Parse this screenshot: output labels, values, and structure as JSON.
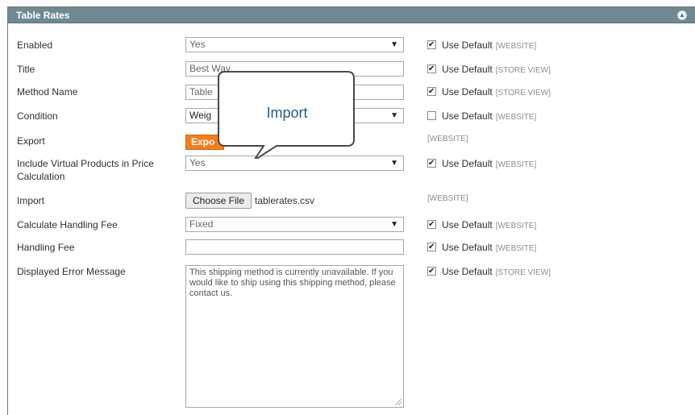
{
  "section": {
    "title": "Table Rates"
  },
  "fields": {
    "enabled": {
      "label": "Enabled",
      "value": "Yes",
      "use_default": "Use Default",
      "scope": "[WEBSITE]",
      "checked": true
    },
    "title": {
      "label": "Title",
      "value": "Best Way",
      "use_default": "Use Default",
      "scope": "[STORE VIEW]",
      "checked": true
    },
    "method_name": {
      "label": "Method Name",
      "value": "Table",
      "use_default": "Use Default",
      "scope": "[STORE VIEW]",
      "checked": true
    },
    "condition": {
      "label": "Condition",
      "value": "Weig",
      "use_default": "Use Default",
      "scope": "[WEBSITE]",
      "checked": false
    },
    "export": {
      "label": "Export",
      "button": "Expo",
      "scope": "[WEBSITE]"
    },
    "include_virtual": {
      "label_line1": "Include Virtual Products in Price",
      "label_line2": "Calculation",
      "value": "Yes",
      "use_default": "Use Default",
      "scope": "[WEBSITE]",
      "checked": true
    },
    "import": {
      "label": "Import",
      "button": "Choose File",
      "filename": "tablerates.csv",
      "scope": "[WEBSITE]"
    },
    "handling_calc": {
      "label": "Calculate Handling Fee",
      "value": "Fixed",
      "use_default": "Use Default",
      "scope": "[WEBSITE]",
      "checked": true
    },
    "handling_fee": {
      "label": "Handling Fee",
      "value": "",
      "use_default": "Use Default",
      "scope": "[WEBSITE]",
      "checked": true
    },
    "error_message": {
      "label": "Displayed Error Message",
      "value": "This shipping method is currently unavailable. If you would like to ship using this shipping method, please contact us.",
      "use_default": "Use Default",
      "scope": "[STORE VIEW]",
      "checked": true
    }
  },
  "callout": {
    "text": "Import"
  },
  "icons": {
    "collapse": "collapse-up-icon",
    "dropdown": "dropdown-arrow-icon",
    "checkbox": "checkbox-icon"
  }
}
